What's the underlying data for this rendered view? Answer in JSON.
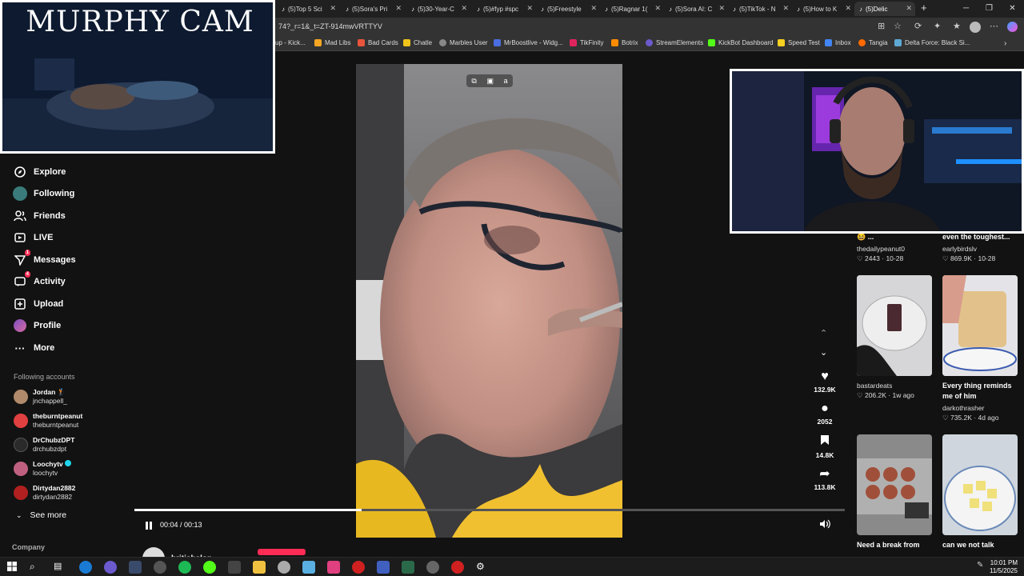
{
  "browser": {
    "tabs": [
      {
        "label": "(5)Top 5 Sci"
      },
      {
        "label": "(5)Sora's Pri"
      },
      {
        "label": "(5)30-Year-C"
      },
      {
        "label": "(5)#fyp #spc"
      },
      {
        "label": "(5)Freestyle"
      },
      {
        "label": "(5)Ragnar 1("
      },
      {
        "label": "(5)Sora AI: C"
      },
      {
        "label": "(5)TikTok - N"
      },
      {
        "label": "(5)How to K"
      },
      {
        "label": "(5)Delic"
      }
    ],
    "url": "74?_r=1&_t=ZT-914mwVRTTYV",
    "bookmarks": [
      {
        "label": "up - Kick...",
        "color": "#3a3a3a"
      },
      {
        "label": "Mad Libs",
        "color": "#f5a623"
      },
      {
        "label": "Bad Cards",
        "color": "#e8543c"
      },
      {
        "label": "Chatle",
        "color": "#f0c419"
      },
      {
        "label": "Marbles User",
        "color": "#888888"
      },
      {
        "label": "MrBoostlive - Widg...",
        "color": "#4a6ee0"
      },
      {
        "label": "TikFinity",
        "color": "#e0245e"
      },
      {
        "label": "Botrix",
        "color": "#ff8c00"
      },
      {
        "label": "StreamElements",
        "color": "#6a5acd"
      },
      {
        "label": "KickBot Dashboard",
        "color": "#53fc18"
      },
      {
        "label": "Speed Test",
        "color": "#f5d020"
      },
      {
        "label": "Inbox",
        "color": "#4285f4"
      },
      {
        "label": "Tangia",
        "color": "#ff6a00"
      },
      {
        "label": "Delta Force: Black Si...",
        "color": "#5fa8d3"
      }
    ]
  },
  "overlay": {
    "murphy_cam_title": "MURPHY CAM"
  },
  "sidebar": {
    "items": [
      {
        "label": "Explore",
        "icon": "compass-icon"
      },
      {
        "label": "Following",
        "icon": "following-icon"
      },
      {
        "label": "Friends",
        "icon": "friends-icon"
      },
      {
        "label": "LIVE",
        "icon": "live-icon"
      },
      {
        "label": "Messages",
        "icon": "messages-icon",
        "badge": "1"
      },
      {
        "label": "Activity",
        "icon": "activity-icon",
        "badge": "4"
      },
      {
        "label": "Upload",
        "icon": "upload-icon"
      },
      {
        "label": "Profile",
        "icon": "profile-icon"
      },
      {
        "label": "More",
        "icon": "more-icon"
      }
    ],
    "following_title": "Following accounts",
    "accounts": [
      {
        "name": "Jordan 🏌",
        "handle": "jnchappell_",
        "color": "#b08a6a"
      },
      {
        "name": "theburntpeanut",
        "handle": "theburntpeanut",
        "color": "#e04040"
      },
      {
        "name": "DrChubzDPT",
        "handle": "drchubzdpt",
        "color": "#2a2a2a"
      },
      {
        "name": "Loochytv",
        "handle": "loochytv",
        "color": "#c06080"
      },
      {
        "name": "Dirtydan2882",
        "handle": "dirtydan2882",
        "color": "#b02020"
      }
    ],
    "see_more": "See more",
    "company": "Company"
  },
  "player": {
    "time": "00:04 / 00:13",
    "progress": 0.32,
    "author": "britishslop"
  },
  "actions": [
    {
      "icon": "heart-icon",
      "count": "132.9K"
    },
    {
      "icon": "comment-icon",
      "count": "2052"
    },
    {
      "icon": "bookmark-icon",
      "count": "14.8K"
    },
    {
      "icon": "share-icon",
      "count": "113.8K"
    }
  ],
  "recommended": {
    "top_row": [
      {
        "caption": "😆 ...",
        "user": "thedailypeanut0",
        "stats": "♡ 2443 · 10-28"
      },
      {
        "caption": "even the toughest...",
        "user": "earlybirdslv",
        "stats": "♡ 869.9K · 10-28"
      }
    ],
    "mid_row": [
      {
        "caption": "",
        "user": "bastardeats",
        "stats": "♡ 206.2K · 1w ago"
      },
      {
        "caption": "Every thing reminds me of him",
        "user": "darkothrasher",
        "stats": "♡ 735.2K · 4d ago"
      }
    ],
    "bottom_row": [
      {
        "caption": "Need a break from"
      },
      {
        "caption": "can we not talk"
      }
    ]
  },
  "taskbar": {
    "time": "10:01 PM",
    "date": "11/5/2025"
  }
}
